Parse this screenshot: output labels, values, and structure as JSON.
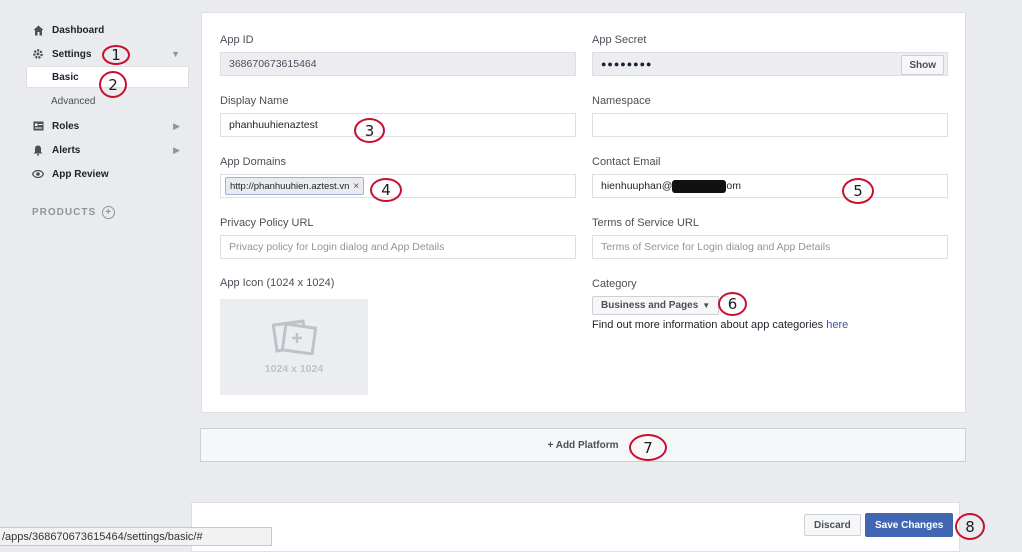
{
  "sidebar": {
    "items": [
      {
        "label": "Dashboard",
        "icon": "home-icon"
      },
      {
        "label": "Settings",
        "icon": "gear-icon"
      },
      {
        "label": "Roles",
        "icon": "id-card-icon"
      },
      {
        "label": "Alerts",
        "icon": "bell-icon"
      },
      {
        "label": "App Review",
        "icon": "eye-icon"
      }
    ],
    "settings_sub": [
      {
        "label": "Basic",
        "active": true
      },
      {
        "label": "Advanced",
        "active": false
      }
    ],
    "products_label": "PRODUCTS"
  },
  "form": {
    "app_id": {
      "label": "App ID",
      "value": "368670673615464"
    },
    "app_secret": {
      "label": "App Secret",
      "value": "●●●●●●●●",
      "show_label": "Show"
    },
    "display_name": {
      "label": "Display Name",
      "value": "phanhuuhienaztest"
    },
    "namespace": {
      "label": "Namespace",
      "value": ""
    },
    "app_domains": {
      "label": "App Domains",
      "token": "http://phanhuuhien.aztest.vn",
      "token_remove": "×"
    },
    "contact_email": {
      "label": "Contact Email",
      "value_prefix": "hienhuuphan@",
      "value_suffix": "om"
    },
    "privacy_policy": {
      "label": "Privacy Policy URL",
      "placeholder": "Privacy policy for Login dialog and App Details"
    },
    "terms_of_service": {
      "label": "Terms of Service URL",
      "placeholder": "Terms of Service for Login dialog and App Details"
    },
    "app_icon": {
      "label": "App Icon (1024 x 1024)",
      "dimension": "1024 x 1024"
    },
    "category": {
      "label": "Category",
      "value": "Business and Pages",
      "note": "Find out more information about app categories ",
      "note_link": "here"
    }
  },
  "add_platform": {
    "label": "+ Add Platform"
  },
  "footer": {
    "discard": "Discard",
    "save": "Save Changes"
  },
  "status_url": "/apps/368670673615464/settings/basic/#",
  "annotations": [
    "1",
    "2",
    "3",
    "4",
    "5",
    "6",
    "7",
    "8"
  ],
  "colors": {
    "accent": "#4267b2",
    "link": "#365899",
    "annotation": "#c8102e",
    "background": "#e9ebee"
  }
}
